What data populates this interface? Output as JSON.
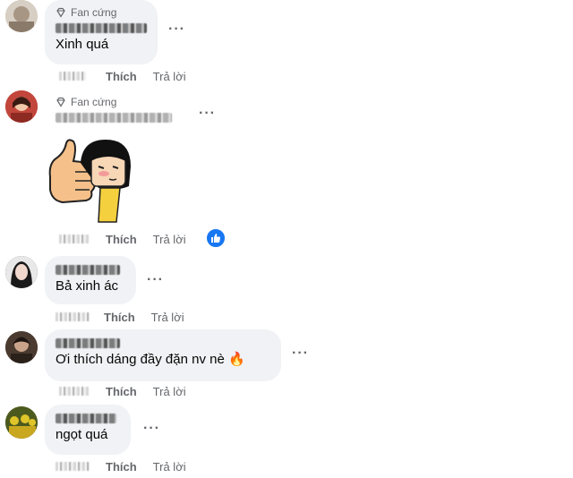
{
  "comments": [
    {
      "badge": "Fan cứng",
      "text": "Xinh quá",
      "like_label": "Thích",
      "reply_label": "Trả lời",
      "avatar_color": "#c9b9a8"
    },
    {
      "badge": "Fan cứng",
      "text": "",
      "like_label": "Thích",
      "reply_label": "Trả lời",
      "avatar_color": "#b3453a",
      "sticker": "thumbs-up-girl-sticker",
      "reaction_icon": "like-icon"
    },
    {
      "badge": "",
      "text": "Bả xinh ác",
      "like_label": "Thích",
      "reply_label": "Trả lời",
      "avatar_color": "#3a3a3a"
    },
    {
      "badge": "",
      "text": "Ơi thích dáng đầy đặn nv nè 🔥",
      "like_label": "Thích",
      "reply_label": "Trả lời",
      "avatar_color": "#5a4a3c"
    },
    {
      "badge": "",
      "text": "ngọt quá",
      "like_label": "Thích",
      "reply_label": "Trả lời",
      "avatar_color": "#6b7b2a"
    }
  ],
  "more_icon": "more-options-icon",
  "colors": {
    "bubble": "#f0f2f5",
    "meta": "#65676b",
    "like_blue": "#1877f2"
  }
}
